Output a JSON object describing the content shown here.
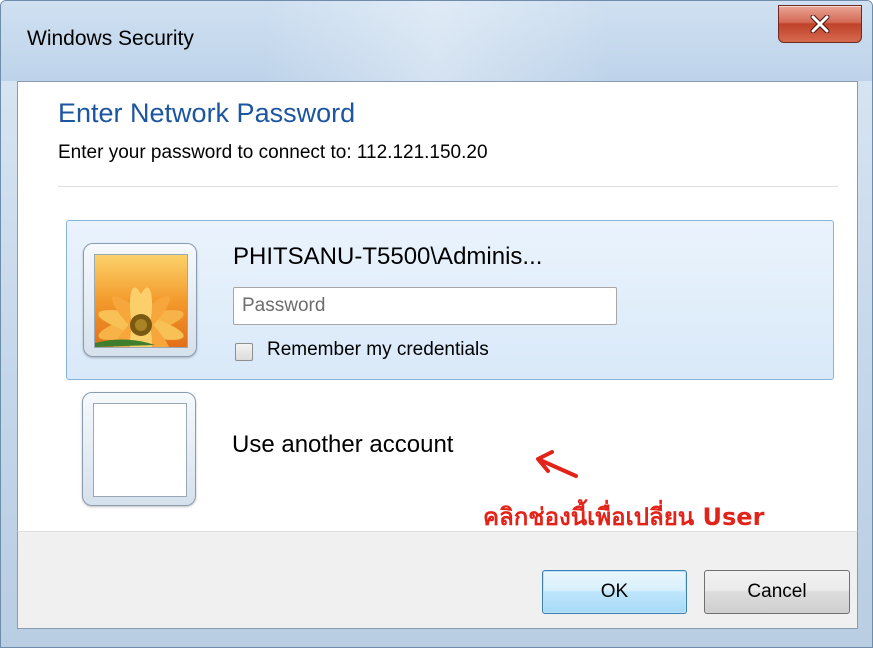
{
  "window": {
    "title": "Windows Security",
    "close_symbol": "x"
  },
  "dialog": {
    "heading": "Enter Network Password",
    "subheading": "Enter your password to connect to: 112.121.150.20"
  },
  "account": {
    "username": "PHITSANU-T5500\\Adminis...",
    "password_placeholder": "Password",
    "password_value": "",
    "remember_label": "Remember my credentials",
    "remember_checked": false,
    "avatar_icon": "flower-avatar-icon"
  },
  "another_account": {
    "label": "Use another account",
    "avatar_icon": "blank-avatar-icon"
  },
  "annotation": {
    "text": "คลิกช่องนี้เพื่อเปลี่ยน User",
    "color": "#e2231a"
  },
  "buttons": {
    "ok": "OK",
    "cancel": "Cancel"
  },
  "colors": {
    "heading": "#1c55a0",
    "selected_tile": "#d9e9f9",
    "close_button": "#c0412a"
  }
}
